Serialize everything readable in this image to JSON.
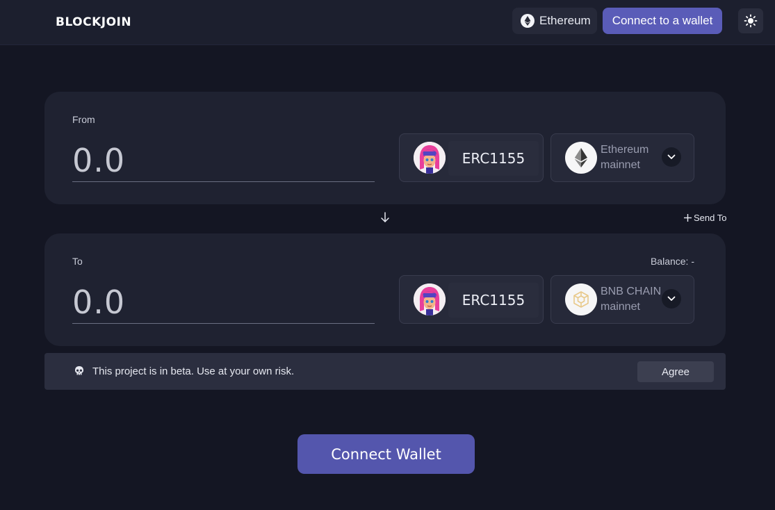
{
  "header": {
    "logo": "BLOCKJOIN",
    "network_label": "Ethereum",
    "connect_label": "Connect to a wallet"
  },
  "from_card": {
    "label": "From",
    "amount_placeholder": "0.0",
    "token": "ERC1155",
    "chain_line1": "Ethereum",
    "chain_line2": "mainnet"
  },
  "swap": {
    "send_to_label": "Send To"
  },
  "to_card": {
    "label": "To",
    "balance_label": "Balance: -",
    "amount_placeholder": "0.0",
    "token": "ERC1155",
    "chain_line1": "BNB CHAIN",
    "chain_line2": "mainnet"
  },
  "banner": {
    "text": "This project is in beta. Use at your own risk.",
    "agree_label": "Agree"
  },
  "main_button": {
    "label": "Connect Wallet"
  },
  "colors": {
    "background": "#141623",
    "card": "#1f2231",
    "accent": "#5a5cb8",
    "bnb": "#f0b90b"
  }
}
